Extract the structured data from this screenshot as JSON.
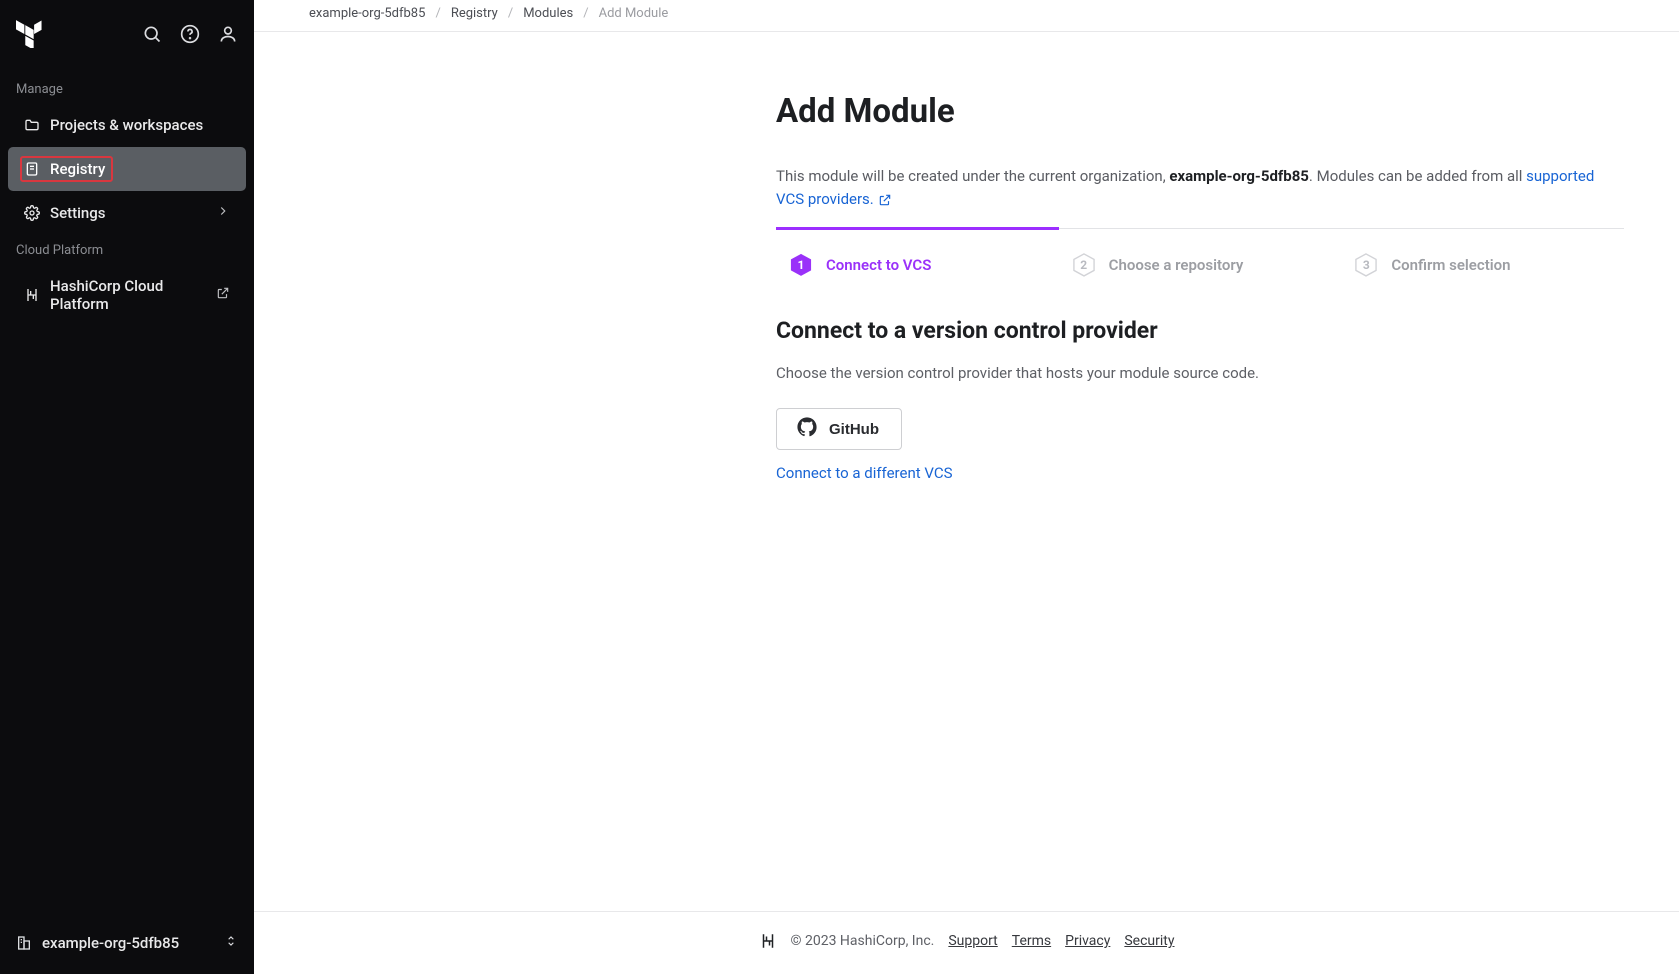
{
  "sidebar": {
    "sections": {
      "manage": "Manage",
      "cloud": "Cloud Platform"
    },
    "items": {
      "projects": "Projects & workspaces",
      "registry": "Registry",
      "settings": "Settings",
      "hcp": "HashiCorp Cloud Platform"
    },
    "org": "example-org-5dfb85"
  },
  "breadcrumbs": {
    "org": "example-org-5dfb85",
    "registry": "Registry",
    "modules": "Modules",
    "current": "Add Module"
  },
  "page": {
    "title": "Add Module",
    "desc_prefix": "This module will be created under the current organization, ",
    "desc_org": "example-org-5dfb85",
    "desc_suffix": ". Modules can be added from all ",
    "desc_link": "supported VCS providers."
  },
  "steps": {
    "s1": {
      "num": "1",
      "label": "Connect to VCS"
    },
    "s2": {
      "num": "2",
      "label": "Choose a repository"
    },
    "s3": {
      "num": "3",
      "label": "Confirm selection"
    }
  },
  "vcs": {
    "heading": "Connect to a version control provider",
    "desc": "Choose the version control provider that hosts your module source code.",
    "github": "GitHub",
    "alt": "Connect to a different VCS"
  },
  "footer": {
    "copyright": "© 2023 HashiCorp, Inc.",
    "support": "Support",
    "terms": "Terms",
    "privacy": "Privacy",
    "security": "Security"
  }
}
